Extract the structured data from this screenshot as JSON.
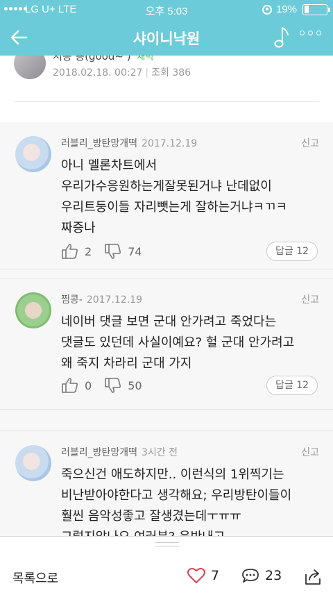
{
  "status_bar": {
    "carrier": "LG U+  LTE",
    "time": "오후 5:03",
    "battery": "19%"
  },
  "header": {
    "title": "샤이니낙원"
  },
  "post": {
    "author": "서동 용(good~  )",
    "badge": "새벽",
    "date": "2018.02.18. 00:27",
    "views": "조회 386"
  },
  "comments": [
    {
      "author": "러블리_방탄망개떡",
      "date": "2017.12.19",
      "report": "신고",
      "lines": [
        "아니 멜론차트에서",
        "우리가수응원하는게잘못된거냐 난데없이",
        "우리트둥이들 자리뺏는게 잘하는거냐ㅋㄲㅋ",
        "짜증나"
      ],
      "likes": "2",
      "dislikes": "74",
      "reply": "답글 12"
    },
    {
      "author": "찜콩-",
      "date": "2017.12.19",
      "report": "신고",
      "lines": [
        "네이버 댓글 보면 군대 안가려고 죽었다는",
        "댓글도 있던데 사실이예요? 헐 군대 안가려고",
        "왜 죽지 차라리 군대 가지"
      ],
      "likes": "0",
      "dislikes": "50",
      "reply": "답글 12"
    },
    {
      "author": "러블리_방탄망개떡",
      "date": "3시간 전",
      "report": "신고",
      "lines": [
        "죽으신건 애도하지만.. 이런식의 1위찍기는",
        "비난받아야한다고 생각해요; 우리방탄이들이",
        "훨씬 음악성좋고 잘생겼는데ㅜㅠㅠ",
        "그렇지않나요 여러분? 응반내고"
      ]
    }
  ],
  "bottom_bar": {
    "list_label": "목록으로",
    "likes": "7",
    "comments": "23"
  },
  "colors": {
    "accent": "#6ccbd9"
  }
}
